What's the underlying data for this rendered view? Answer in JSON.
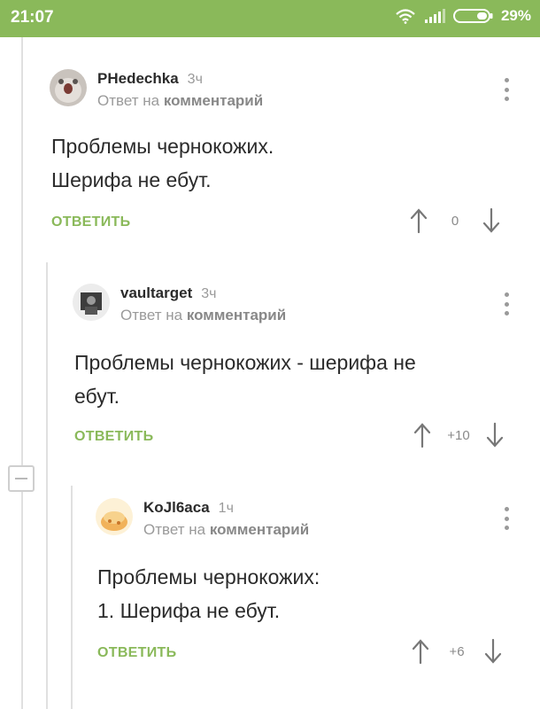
{
  "status_bar": {
    "time": "21:07",
    "battery": "29%"
  },
  "comments": [
    {
      "author": "PHedechka",
      "age": "3ч",
      "reply_prefix": "Ответ на",
      "reply_link": "комментарий",
      "lines": [
        "Проблемы чернокожих.",
        "Шерифа не ебут."
      ],
      "reply_label": "ОТВЕТИТЬ",
      "score": "0"
    },
    {
      "author": "vaultarget",
      "age": "3ч",
      "reply_prefix": "Ответ на",
      "reply_link": "комментарий",
      "lines": [
        "Проблемы чернокожих - шерифа не",
        "ебут."
      ],
      "reply_label": "ОТВЕТИТЬ",
      "score": "+10"
    },
    {
      "author": "KoJl6aca",
      "age": "1ч",
      "reply_prefix": "Ответ на",
      "reply_link": "комментарий",
      "lines": [
        "Проблемы чернокожих:",
        "1. Шерифа не ебут."
      ],
      "reply_label": "ОТВЕТИТЬ",
      "score": "+6"
    }
  ],
  "colors": {
    "accent": "#8ab95a",
    "muted": "#9a9a9a",
    "line": "#e0e0e0"
  }
}
